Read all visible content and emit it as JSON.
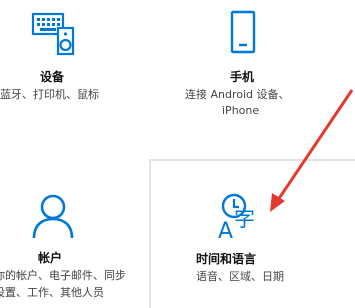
{
  "accent_color": "#0078d7",
  "annotation_color": "#e23a2e",
  "tiles": [
    {
      "id": "devices",
      "icon": "keyboard-speaker-icon",
      "title": "设备",
      "desc_lines": [
        "蓝牙、打印机、鼠标"
      ]
    },
    {
      "id": "phone",
      "icon": "phone-icon",
      "title": "手机",
      "desc_lines": [
        "连接 Android 设备、",
        "iPhone"
      ]
    },
    {
      "id": "accounts",
      "icon": "person-icon",
      "title": "帐户",
      "desc_lines": [
        "你的帐户、电子邮件、同步",
        "设置、工作、其他人员"
      ]
    },
    {
      "id": "time-language",
      "icon": "time-language-icon",
      "title": "时间和语言",
      "desc_lines": [
        "语音、区域、日期"
      ]
    }
  ]
}
